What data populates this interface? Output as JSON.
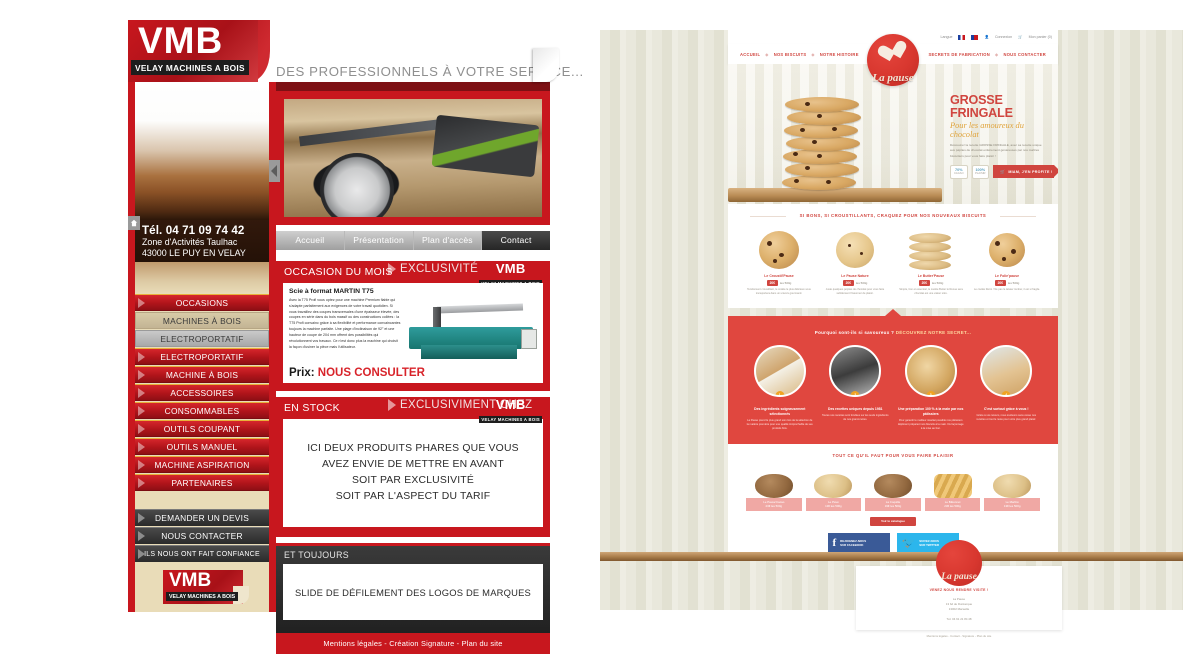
{
  "vmb": {
    "logo": {
      "title": "VMB",
      "subtitle": "VELAY MACHINES A BOIS"
    },
    "tagline": "DES PROFESSIONNELS À VOTRE SERVICE...",
    "contact": {
      "phone": "Tél. 04 71 09 74 42",
      "address_line1": "Zone d'Activités Taulhac",
      "address_line2": "43000 LE PUY EN VELAY"
    },
    "home_icon": "home-icon",
    "sidebar_tab_icon": "collapse-arrow-icon",
    "menu": [
      {
        "label": "OCCASIONS",
        "style": "red"
      },
      {
        "label": "MACHINES À BOIS",
        "style": "tan"
      },
      {
        "label": "ELECTROPORTATIF",
        "style": "grey"
      },
      {
        "label": "ELECTROPORTATIF",
        "style": "red"
      },
      {
        "label": "MACHINE À BOIS",
        "style": "red"
      },
      {
        "label": "ACCESSOIRES",
        "style": "red"
      },
      {
        "label": "CONSOMMABLES",
        "style": "red"
      },
      {
        "label": "OUTILS COUPANT",
        "style": "red"
      },
      {
        "label": "OUTILS MANUEL",
        "style": "red"
      },
      {
        "label": "MACHINE ASPIRATION",
        "style": "red"
      },
      {
        "label": "PARTENAIRES",
        "style": "red"
      }
    ],
    "menu2": [
      {
        "label": "DEMANDER UN DEVIS",
        "style": "dark"
      },
      {
        "label": "NOUS CONTACTER",
        "style": "dark"
      },
      {
        "label": "ILS NOUS ONT FAIT CONFIANCE",
        "style": "dark",
        "tiny": true
      }
    ],
    "tabs": [
      {
        "label": "Accueil",
        "active": false
      },
      {
        "label": "Présentation",
        "active": false
      },
      {
        "label": "Plan d'accès",
        "active": false
      },
      {
        "label": "Contact",
        "active": true
      }
    ],
    "panel_occasion": {
      "title": "OCCASION DU MOIS",
      "exclusivity": "EXCLUSIVITÉ",
      "product_title": "Scie à format  MARTIN T75",
      "product_body": "Avec la T75 Profi vous optez pour une machine Premium fiable qui s'adapte parfaitement aux exigences de votre travail quotidien. Si vous travaillez des coupes transversales d'une épaisseur élevée, des coupes en série dans du bois massif ou des constructions collées : la T75 Profi convainc grâce à sa flexibilité et performance convaincantes toujours la machine parfaite. Une plage d'inclinaison de 92° et une hauteur de coupe de 204 mm offrent des possibilités qui révolutionnent vos travaux. Ce n'est donc plus la machine qui choisit la façon d'usiner la pièce mais l'utilisateur.",
      "price_label": "Prix:",
      "price_value": "NOUS CONSULTER"
    },
    "panel_stock": {
      "title": "EN STOCK",
      "exclusivity": "EXCLUSIVIMENT CHEZ",
      "lines": [
        "ICI DEUX PRODUITS PHARES QUE VOUS",
        "AVEZ ENVIE DE METTRE EN AVANT",
        "SOIT PAR EXCLUSIVITÉ",
        "SOIT PAR L'ASPECT DU TARIF"
      ]
    },
    "panel_always": {
      "title": "ET TOUJOURS",
      "slide_text": "SLIDE DE DÉFILEMENT DES LOGOS DE MARQUES"
    },
    "footer": "Mentions légales - Création Signature - Plan du site",
    "colors": {
      "red": "#c8171e",
      "tan": "#e9dcb8",
      "dark": "#262626"
    }
  },
  "pause": {
    "utility": {
      "lang_label": "Langue",
      "flags": [
        "flag-fr-icon",
        "flag-en-icon"
      ],
      "account_icon": "user-icon",
      "account_label": "Connexion",
      "cart_icon": "cart-icon",
      "cart_label": "Mon panier (0)"
    },
    "logo": {
      "brand": "La pause",
      "icon": "heart-cookie-icon"
    },
    "nav_left": [
      "ACCUEIL",
      "NOS BISCUITS",
      "NOTRE HISTOIRE"
    ],
    "nav_right": [
      "SECRETS DE FABRICATION",
      "NOUS CONTACTER"
    ],
    "hero": {
      "title": "GROSSE FRINGALE",
      "subtitle": "Pour les amoureux du chocolat",
      "body": "Découvrez la recette GROSSE FRINGALE, avec sa recette unique aux pépites de chocolat entièrement généreuses par nos maîtres biscuitiers pour vous faire plaisir !",
      "badges": [
        {
          "value": "70%",
          "label": "CACAO"
        },
        {
          "value": "100%",
          "label": "PLAISIR"
        }
      ],
      "cta": "MIAM, J'EN PROFITE !",
      "cta_icon": "cart-icon"
    },
    "new_products": {
      "title": "SI BONS, SI CROUSTILLANTS, CRAQUEZ POUR NOS NOUVEAUX BISCUITS",
      "items": [
        {
          "name": "Le Croustil'Pause",
          "price": "20€",
          "unit": "les 500g",
          "desc": "Tendrement croustillant, le cookie le plus délicieux vous transportera dans un univers gourmand."
        },
        {
          "name": "Le Pause Nature",
          "price": "20€",
          "unit": "les 500g",
          "desc": "Juste quelques pépites de chocolat pour vous faire subtilement frissonner de plaisir."
        },
        {
          "name": "Le Butter'Pause",
          "price": "20€",
          "unit": "les 500g",
          "desc": "Simple, bon et essentiel, le cookie Butter le Recue sera chocolat est une valeur sûre."
        },
        {
          "name": "Le Folie'pause",
          "price": "20€",
          "unit": "les 500g",
          "desc": "Le cookie Retro ! Ne pas le laisser tomber, il est si fragile."
        }
      ]
    },
    "secret": {
      "question": "Pourquoi sont-ils si savoureux ?",
      "highlight": "DÉCOUVREZ NOTRE SECRET...",
      "items": [
        {
          "num": "1",
          "title": "Des ingrédients soigneusement sélectionnés",
          "desc": "La Pause prend le plus grand soin lors de la sélection de la matière première pour une qualité irréprochable de ses produits finis."
        },
        {
          "num": "2",
          "title": "Des recettes uniques depuis 1981",
          "desc": "Toutes nos recettes sont fondées sur les seuls ingrédients de nos grand-mères."
        },
        {
          "num": "3",
          "title": "Une préparation 100 % à la main par nos pâtissiers",
          "desc": "Pour garantir le meilleur résultat possible nos pâtissiers déplorent préparent nos biscuits à la main. Du façonnage à la mise au four."
        },
        {
          "num": "4",
          "title": "C'est surtout grâce à vous !",
          "desc": "Grâce à vos retours, nous évoluons sans cesse nos recettes et tout le reste pour votre plus grand plaisir."
        }
      ]
    },
    "range": {
      "title": "TOUT CE QU'IL FAUT POUR VOUS FAIRE PLAISIR",
      "items": [
        {
          "name": "Le Pause'Cacao",
          "price": "23€ les 500g"
        },
        {
          "name": "Le Pavé",
          "price": "13€ les 500g"
        },
        {
          "name": "La Coquille",
          "price": "19€ les 500g"
        },
        {
          "name": "Le Bâtonnet",
          "price": "23€ les 500g"
        },
        {
          "name": "Le Marbré",
          "price": "13€ les 500g"
        }
      ],
      "catalog_button": "Voir le catalogue"
    },
    "socials": [
      {
        "icon": "facebook-icon",
        "glyph": "f",
        "line1": "REJOIGNEZ-NOUS",
        "line2": "SUR FACEBOOK"
      },
      {
        "icon": "twitter-icon",
        "glyph": "t",
        "line1": "SUIVEZ-NOUS",
        "line2": "SUR TWITTER"
      }
    ],
    "footer": {
      "visit_title": "VENEZ NOUS RENDRE VISITE !",
      "name": "La Pause",
      "street": "13 bd de Dunkerque",
      "city": "13002 Marseille",
      "phone": "Tél. 04 91 21 84 48",
      "links": "Mentions légales - Contact - Signature - Plan du site"
    },
    "colors": {
      "red": "#d0453f",
      "red_band": "#e0473f",
      "gold": "#e0a43c",
      "stripe": "#e9e8dc"
    }
  }
}
